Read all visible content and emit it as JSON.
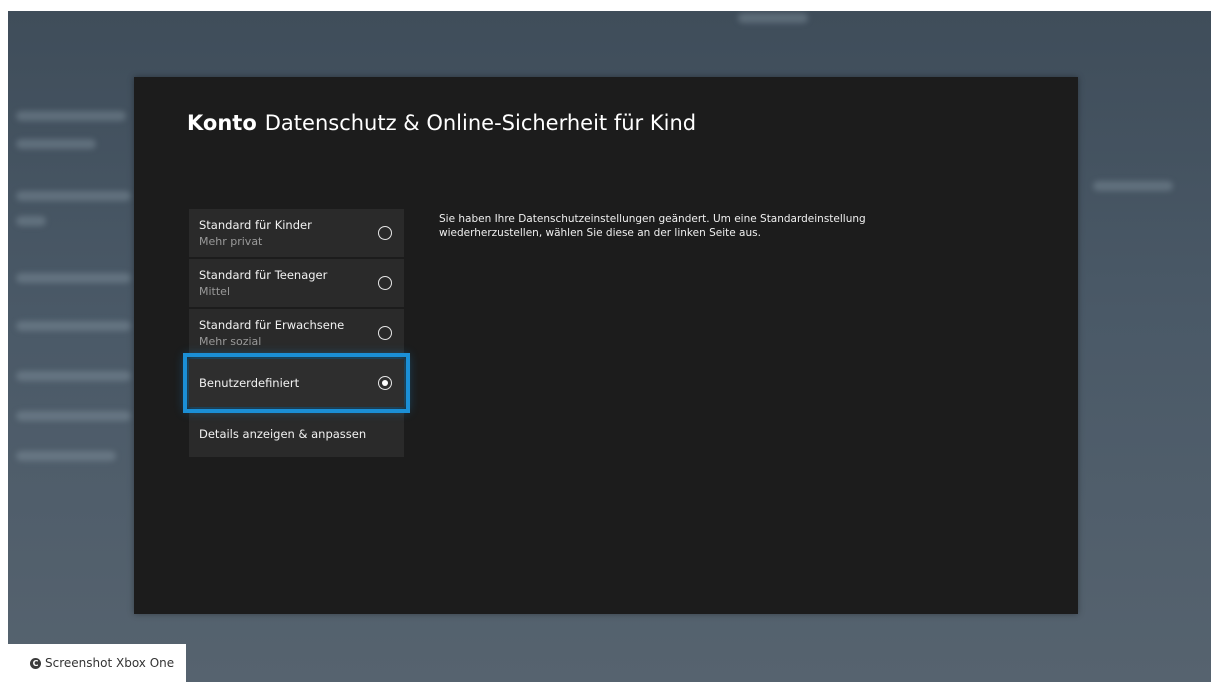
{
  "header": {
    "brand": "Konto",
    "subtitle": "Datenschutz & Online-Sicherheit für Kind"
  },
  "options": [
    {
      "label": "Standard für Kinder",
      "sublabel": "Mehr privat",
      "selected": false
    },
    {
      "label": "Standard für Teenager",
      "sublabel": "Mittel",
      "selected": false
    },
    {
      "label": "Standard für Erwachsene",
      "sublabel": "Mehr sozial",
      "selected": false
    },
    {
      "label": "Benutzerdefiniert",
      "selected": true,
      "focused": true
    },
    {
      "label": "Details anzeigen & anpassen"
    }
  ],
  "message": "Sie haben Ihre Datenschutzeinstellungen geändert. Um eine Standardeinstellung wiederherzustellen, wählen Sie diese an der linken Seite aus.",
  "caption": {
    "icon": "copyright-icon",
    "text": "Screenshot Xbox One"
  },
  "colors": {
    "accent": "#1b8fd6",
    "panel": "#1c1c1c",
    "background": "#46535f"
  }
}
